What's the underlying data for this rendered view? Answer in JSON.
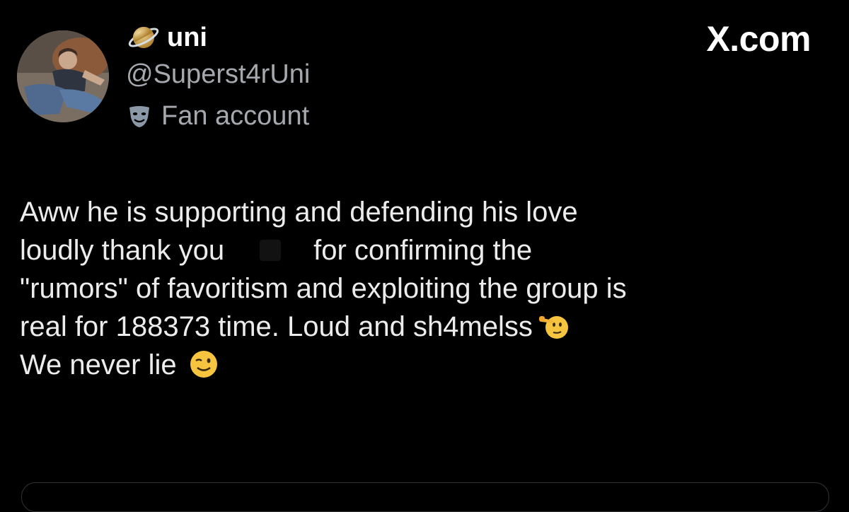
{
  "header": {
    "display_name": "uni",
    "handle": "@Superst4rUni",
    "account_label": "Fan account",
    "brand": "X.com"
  },
  "post": {
    "line1": "Aww he is supporting and defending his love",
    "line2_start": "loudly thank you",
    "line2_end": "for confirming the",
    "line3": "\"rumors\" of favoritism and exploiting the group is",
    "line4": "real for 188373 time. Loud and sh4melss",
    "line5": "We never lie"
  },
  "icons": {
    "name_badge": "ringed-planet-icon",
    "label_badge": "performing-arts-icon",
    "emoji_1": "saluting-face-icon",
    "emoji_2": "winking-face-icon"
  },
  "colors": {
    "background": "#000000",
    "primary_text": "#ffffff",
    "secondary_text": "#a5a9ae"
  }
}
